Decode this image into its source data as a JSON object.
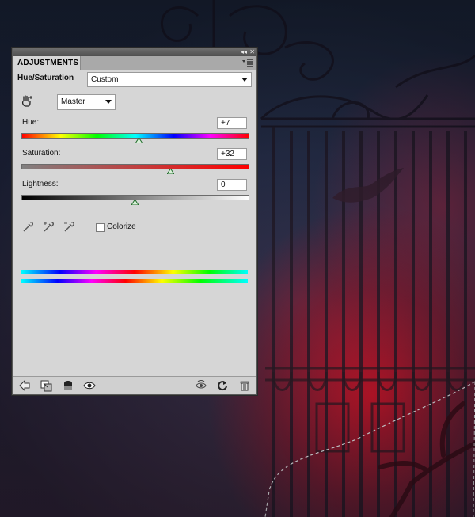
{
  "panel": {
    "tab_label": "ADJUSTMENTS",
    "adjustment_title": "Hue/Saturation",
    "preset": "Custom",
    "channel": "Master"
  },
  "sliders": {
    "hue": {
      "label": "Hue:",
      "value": "+7",
      "position": 0.52
    },
    "saturation": {
      "label": "Saturation:",
      "value": "+32",
      "position": 0.66
    },
    "lightness": {
      "label": "Lightness:",
      "value": "0",
      "position": 0.5
    }
  },
  "colorize": {
    "label": "Colorize",
    "checked": false
  },
  "icons": {
    "panel_header": [
      "collapse-icon",
      "close-icon",
      "panel-menu-icon"
    ],
    "controls": [
      "targeted-adjustment-hand-icon",
      "eyedropper-icon",
      "eyedropper-plus-icon",
      "eyedropper-minus-icon"
    ],
    "footer": [
      "return-to-list-icon",
      "clip-to-layer-icon",
      "layer-mask-icon",
      "visibility-eye-icon",
      "view-previous-state-icon",
      "reset-icon",
      "trash-icon"
    ]
  },
  "colors": {
    "panel_bg": "#d6d6d6",
    "thumb_green": "#2c8a3a",
    "background_red": "#d0142a",
    "background_blue": "#24304a"
  }
}
